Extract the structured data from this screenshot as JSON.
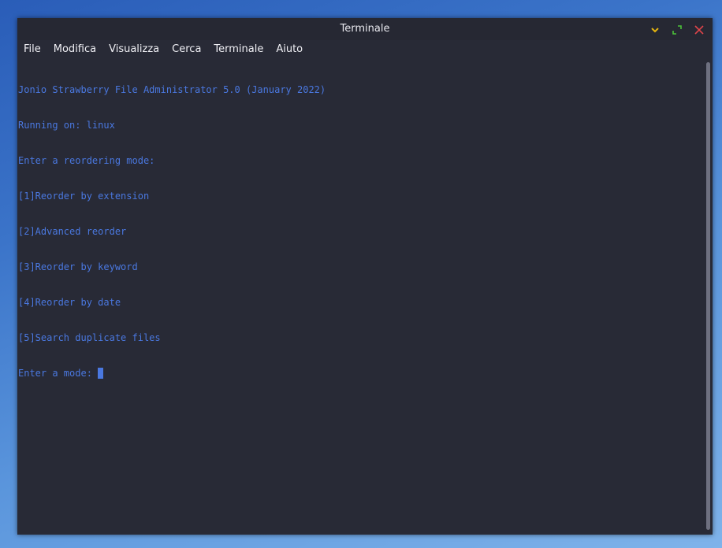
{
  "window": {
    "title": "Terminale",
    "controls": [
      {
        "name": "minimize-icon",
        "color": "#e5b50f"
      },
      {
        "name": "maximize-icon",
        "color": "#4cc23a"
      },
      {
        "name": "close-icon",
        "color": "#e0454a"
      }
    ]
  },
  "menu": {
    "items": [
      "File",
      "Modifica",
      "Visualizza",
      "Cerca",
      "Terminale",
      "Aiuto"
    ]
  },
  "terminal": {
    "text_color": "#4a78e0",
    "background": "#282a36",
    "lines": [
      "Jonio Strawberry File Administrator 5.0 (January 2022)",
      "Running on: linux",
      "Enter a reordering mode:",
      "[1]Reorder by extension",
      "[2]Advanced reorder",
      "[3]Reorder by keyword",
      "[4]Reorder by date",
      "[5]Search duplicate files"
    ],
    "prompt": "Enter a mode: "
  }
}
